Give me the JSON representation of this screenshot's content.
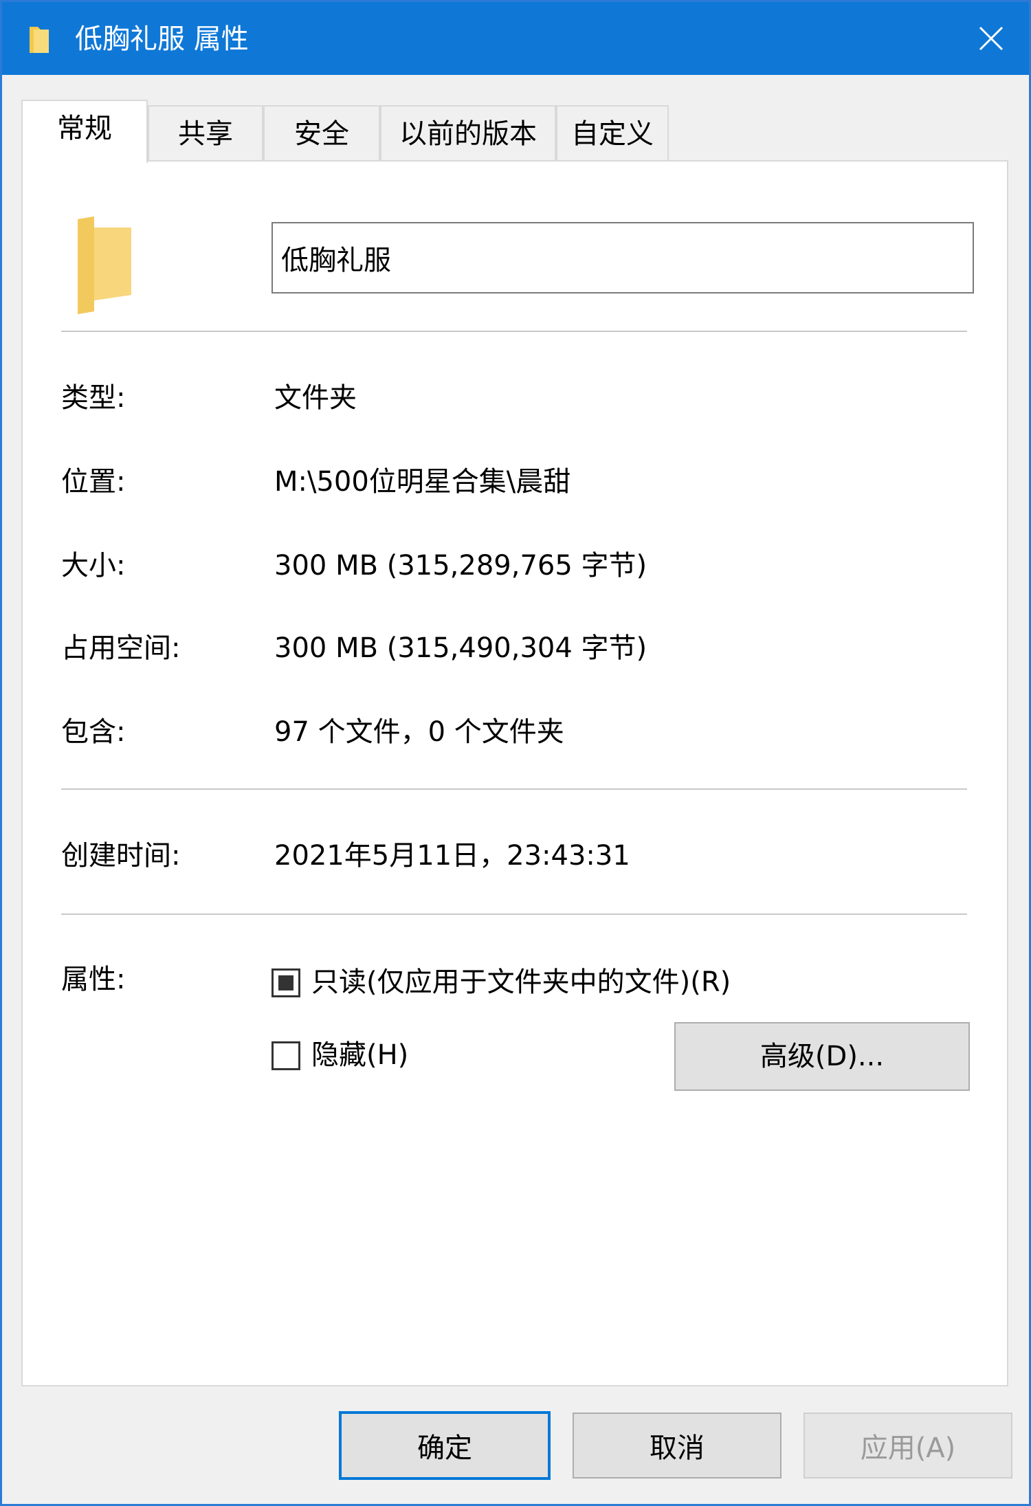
{
  "window": {
    "title": "低胸礼服 属性"
  },
  "tabs": [
    {
      "label": "常规",
      "active": true
    },
    {
      "label": "共享",
      "active": false
    },
    {
      "label": "安全",
      "active": false
    },
    {
      "label": "以前的版本",
      "active": false
    },
    {
      "label": "自定义",
      "active": false
    }
  ],
  "general": {
    "name_value": "低胸礼服",
    "type_label": "类型:",
    "type_value": "文件夹",
    "location_label": "位置:",
    "location_value": "M:\\500位明星合集\\晨甜",
    "size_label": "大小:",
    "size_value": "300 MB (315,289,765 字节)",
    "disk_label": "占用空间:",
    "disk_value": "300 MB (315,490,304 字节)",
    "contains_label": "包含:",
    "contains_value": "97 个文件，0 个文件夹",
    "created_label": "创建时间:",
    "created_value": "2021年5月11日，23:43:31",
    "attributes_label": "属性:",
    "readonly_label": "只读(仅应用于文件夹中的文件)(R)",
    "readonly_state": "indeterminate",
    "hidden_label": "隐藏(H)",
    "hidden_state": "unchecked",
    "advanced_label": "高级(D)..."
  },
  "footer": {
    "ok_label": "确定",
    "cancel_label": "取消",
    "apply_label": "应用(A)"
  },
  "icons": {
    "title": "folder-icon",
    "close": "close-icon",
    "large": "folder-icon"
  },
  "colors": {
    "titlebar": "#0f78d7",
    "accent": "#0078d7",
    "folder": "#f3d27a"
  }
}
